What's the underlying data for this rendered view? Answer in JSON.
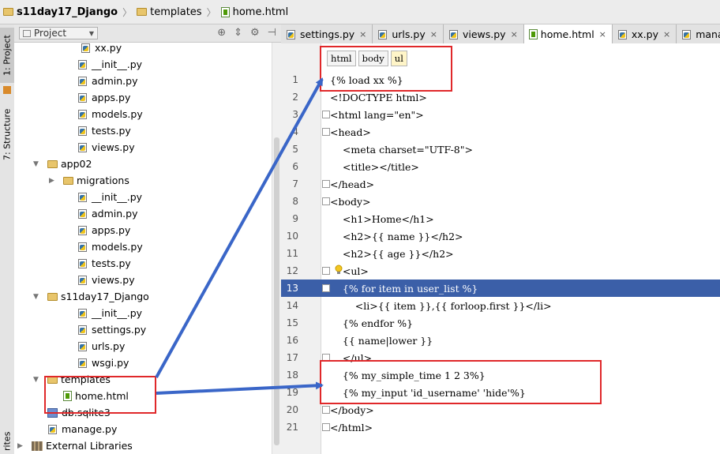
{
  "breadcrumb": {
    "items": [
      {
        "label": "s11day17_Django",
        "icon": "folder-icon",
        "bold": true
      },
      {
        "label": "templates",
        "icon": "folder-icon"
      },
      {
        "label": "home.html",
        "icon": "html-file-icon"
      }
    ]
  },
  "side_strip": {
    "project_tab": "1: Project",
    "structure_tab": "7: Structure",
    "bottom_tab": "rites"
  },
  "project_panel": {
    "selector_label": "Project",
    "tree": [
      {
        "label": "xx.py",
        "icon": "python-file-icon"
      },
      {
        "label": "__init__.py",
        "icon": "python-file-icon"
      },
      {
        "label": "admin.py",
        "icon": "python-file-icon"
      },
      {
        "label": "apps.py",
        "icon": "python-file-icon"
      },
      {
        "label": "models.py",
        "icon": "python-file-icon"
      },
      {
        "label": "tests.py",
        "icon": "python-file-icon"
      },
      {
        "label": "views.py",
        "icon": "python-file-icon"
      },
      {
        "label": "app02",
        "icon": "folder-icon",
        "expanded": true
      },
      {
        "label": "migrations",
        "icon": "folder-icon",
        "expanded": false
      },
      {
        "label": "__init__.py",
        "icon": "python-file-icon"
      },
      {
        "label": "admin.py",
        "icon": "python-file-icon"
      },
      {
        "label": "apps.py",
        "icon": "python-file-icon"
      },
      {
        "label": "models.py",
        "icon": "python-file-icon"
      },
      {
        "label": "tests.py",
        "icon": "python-file-icon"
      },
      {
        "label": "views.py",
        "icon": "python-file-icon"
      },
      {
        "label": "s11day17_Django",
        "icon": "folder-icon",
        "expanded": true
      },
      {
        "label": "__init__.py",
        "icon": "python-file-icon"
      },
      {
        "label": "settings.py",
        "icon": "python-file-icon"
      },
      {
        "label": "urls.py",
        "icon": "python-file-icon"
      },
      {
        "label": "wsgi.py",
        "icon": "python-file-icon"
      },
      {
        "label": "templates",
        "icon": "folder-icon",
        "expanded": true
      },
      {
        "label": "home.html",
        "icon": "html-file-icon"
      },
      {
        "label": "db.sqlite3",
        "icon": "database-icon"
      },
      {
        "label": "manage.py",
        "icon": "python-file-icon"
      },
      {
        "label": "External Libraries",
        "icon": "library-icon",
        "expanded": false
      }
    ]
  },
  "editor_tabs": [
    {
      "label": "settings.py",
      "icon": "python-file-icon",
      "active": false
    },
    {
      "label": "urls.py",
      "icon": "python-file-icon",
      "active": false
    },
    {
      "label": "views.py",
      "icon": "python-file-icon",
      "active": false
    },
    {
      "label": "home.html",
      "icon": "html-file-icon",
      "active": true
    },
    {
      "label": "xx.py",
      "icon": "python-file-icon",
      "active": false
    },
    {
      "label": "manag",
      "icon": "python-file-icon",
      "active": false
    }
  ],
  "tag_breadcrumb": [
    "html",
    "body",
    "ul"
  ],
  "code_lines": [
    {
      "n": "1",
      "text": "{% load xx %}"
    },
    {
      "n": "2",
      "text": "<!DOCTYPE html>"
    },
    {
      "n": "3",
      "text": "<html lang=\"en\">"
    },
    {
      "n": "4",
      "text": "<head>"
    },
    {
      "n": "5",
      "text": "    <meta charset=\"UTF-8\">"
    },
    {
      "n": "6",
      "text": "    <title></title>"
    },
    {
      "n": "7",
      "text": "</head>"
    },
    {
      "n": "8",
      "text": "<body>"
    },
    {
      "n": "9",
      "text": "    <h1>Home</h1>"
    },
    {
      "n": "10",
      "text": "    <h2>{{ name }}</h2>"
    },
    {
      "n": "11",
      "text": "    <h2>{{ age }}</h2>"
    },
    {
      "n": "12",
      "text": "    <ul>"
    },
    {
      "n": "13",
      "text": "    {% for item in user_list %}",
      "highlighted": true
    },
    {
      "n": "14",
      "text": "        <li>{{ item }},{{ forloop.first }}</li>"
    },
    {
      "n": "15",
      "text": "    {% endfor %}"
    },
    {
      "n": "16",
      "text": "    {{ name|lower }}"
    },
    {
      "n": "17",
      "text": "    </ul>"
    },
    {
      "n": "18",
      "text": "    {% my_simple_time 1 2 3%}"
    },
    {
      "n": "19",
      "text": "    {% my_input 'id_username' 'hide'%}"
    },
    {
      "n": "20",
      "text": "</body>"
    },
    {
      "n": "21",
      "text": "</html>"
    }
  ],
  "colors": {
    "annotation_red": "#e0282a",
    "annotation_arrow": "#3a66c8",
    "line_highlight": "#3b5fa8"
  }
}
